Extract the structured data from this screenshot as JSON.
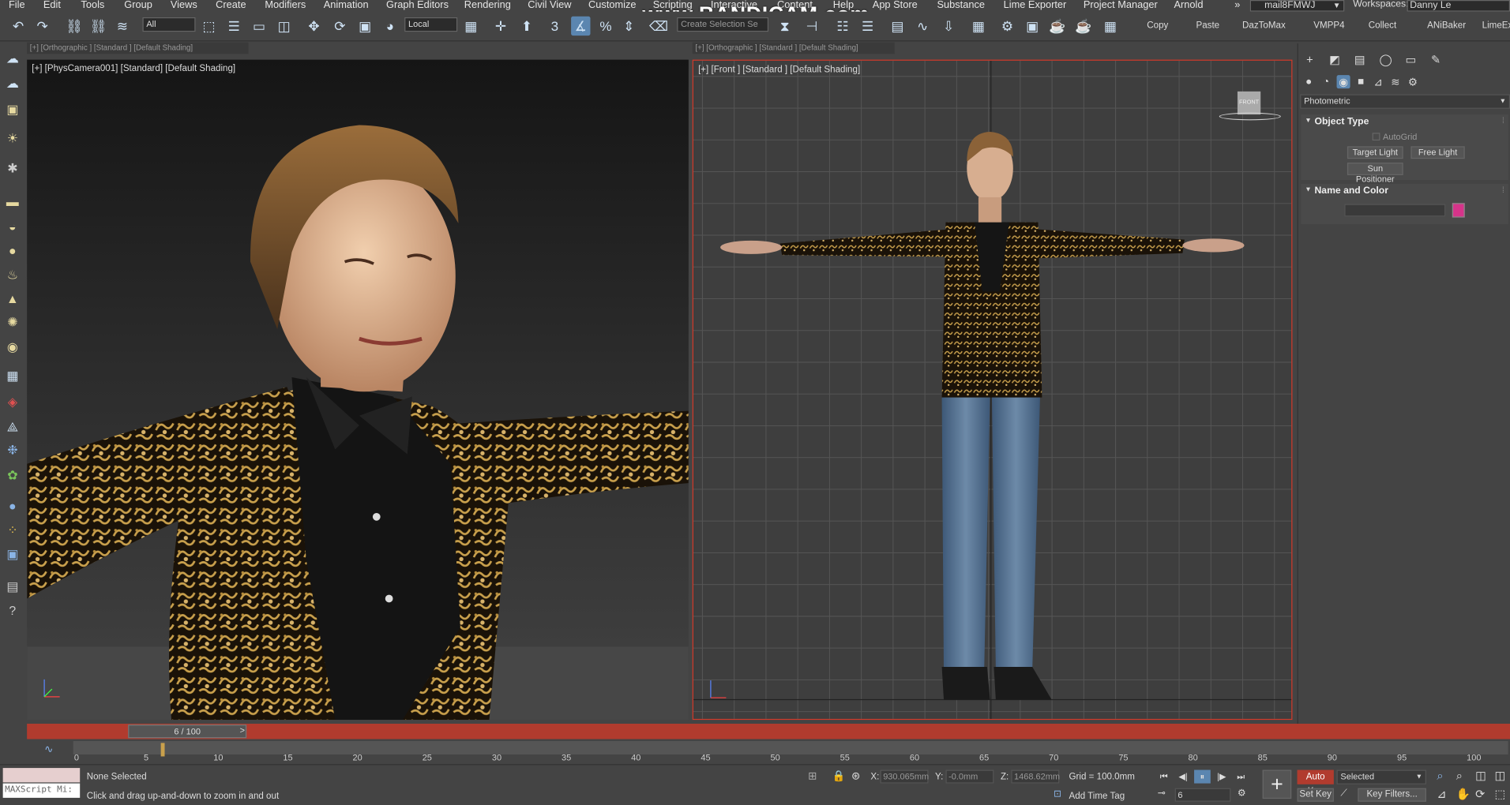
{
  "menu": [
    "File",
    "Edit",
    "Tools",
    "Group",
    "Views",
    "Create",
    "Modifiers",
    "Animation",
    "Graph Editors",
    "Rendering",
    "Civil View",
    "Customize",
    "Scripting",
    "Interactive",
    "Content",
    "Help",
    "App Store",
    "Substance",
    "Lime Exporter",
    "Project Manager",
    "Arnold"
  ],
  "account": "mail8FMWJ",
  "workspace_label": "Workspaces:",
  "workspace": "Danny Le",
  "watermark": "www.BANDICAM.com",
  "toolbar": {
    "selection_filter": "All",
    "ref_coord": "Local",
    "named_sel_placeholder": "Create Selection Se",
    "buttons": [
      "Copy",
      "Paste",
      "DazToMax",
      "VMPP4",
      "Collect",
      "ANiBaker",
      "LimeExp"
    ]
  },
  "viewports": {
    "left": {
      "label": "[+] [PhysCamera001] [Standard] [Default Shading]",
      "hidden_label": "[+] [Orthographic ] [Standard ] [Default Shading]"
    },
    "right": {
      "label": "[+] [Front ] [Standard ] [Default Shading]",
      "hidden_label": "[+] [Orthographic ] [Standard ] [Default Shading]",
      "viewcube": "FRONT"
    }
  },
  "command_panel": {
    "dropdown": "Photometric",
    "object_type": {
      "title": "Object Type",
      "autogrid": "AutoGrid",
      "buttons": [
        "Target Light",
        "Free Light",
        "Sun Positioner"
      ]
    },
    "name_color": {
      "title": "Name and Color",
      "color": "#d6338a"
    }
  },
  "timeline": {
    "slider": "6 / 100",
    "ticks": [
      "0",
      "5",
      "10",
      "15",
      "20",
      "25",
      "30",
      "35",
      "40",
      "45",
      "50",
      "55",
      "60",
      "65",
      "70",
      "75",
      "80",
      "85",
      "90",
      "95",
      "100"
    ],
    "current_frame": 6
  },
  "status": {
    "maxscript": "MAXScript Mi:",
    "selection": "None Selected",
    "prompt": "Click and drag up-and-down to zoom in and out",
    "x_label": "X:",
    "x": "930.065mm",
    "y_label": "Y:",
    "y": "-0.0mm",
    "z_label": "Z:",
    "z": "1468.62mm",
    "grid": "Grid = 100.0mm",
    "add_time_tag": "Add Time Tag",
    "auto_key": "Auto Key",
    "set_key": "Set Key",
    "key_mode": "Selected",
    "frame_field": "6",
    "key_filters": "Key Filters..."
  }
}
